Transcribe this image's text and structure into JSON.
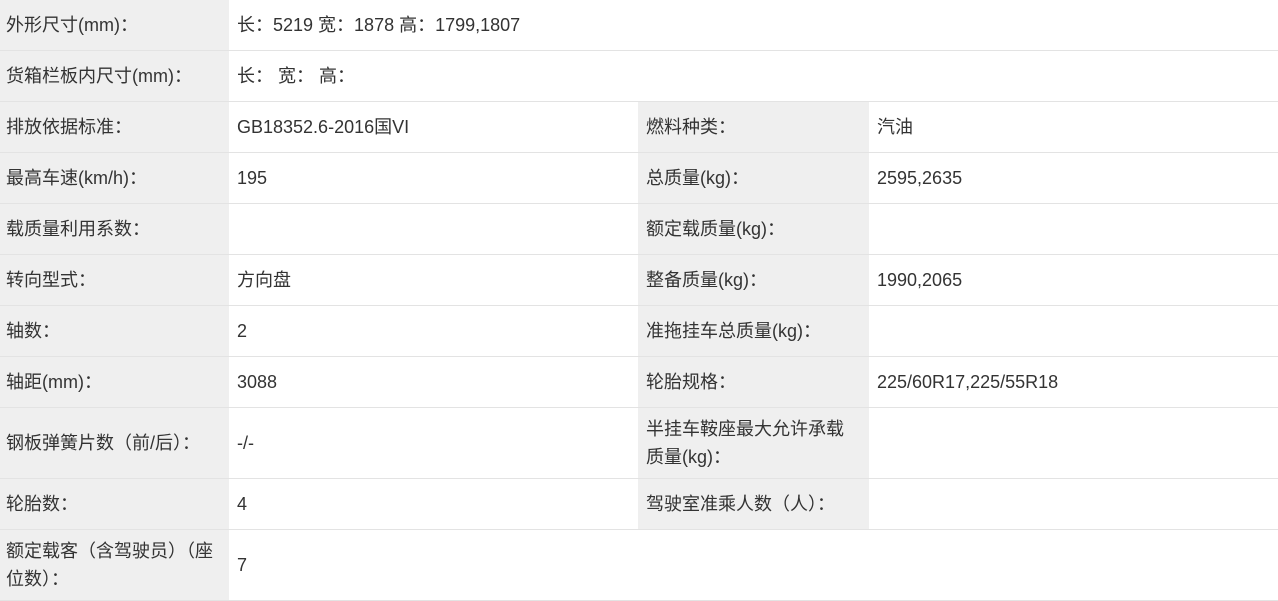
{
  "spec_table": {
    "rows": [
      {
        "label": "外形尺寸(mm)：",
        "value": "长：5219 宽：1878 高：1799,1807"
      },
      {
        "label": "货箱栏板内尺寸(mm)：",
        "value": "长： 宽： 高："
      },
      {
        "label": "排放依据标准：",
        "value": "GB18352.6-2016国VI",
        "label2": "燃料种类：",
        "value2": "汽油"
      },
      {
        "label": "最高车速(km/h)：",
        "value": "195",
        "label2": "总质量(kg)：",
        "value2": "2595,2635"
      },
      {
        "label": "载质量利用系数：",
        "value": "",
        "label2": "额定载质量(kg)：",
        "value2": ""
      },
      {
        "label": "转向型式：",
        "value": "方向盘",
        "label2": "整备质量(kg)：",
        "value2": "1990,2065"
      },
      {
        "label": "轴数：",
        "value": "2",
        "label2": "准拖挂车总质量(kg)：",
        "value2": ""
      },
      {
        "label": "轴距(mm)：",
        "value": "3088",
        "label2": "轮胎规格：",
        "value2": "225/60R17,225/55R18"
      },
      {
        "label": "钢板弹簧片数（前/后）：",
        "value": "-/-",
        "label2": "半挂车鞍座最大允许承载质量(kg)：",
        "value2": ""
      },
      {
        "label": "轮胎数：",
        "value": "4",
        "label2": "驾驶室准乘人数（人）：",
        "value2": ""
      },
      {
        "label": "额定载客（含驾驶员）（座位数）：",
        "value": "7"
      }
    ]
  },
  "colors": {
    "label_bg": "#efefef",
    "value_bg": "#ffffff",
    "text": "#333333",
    "border": "#e3e3e3"
  }
}
